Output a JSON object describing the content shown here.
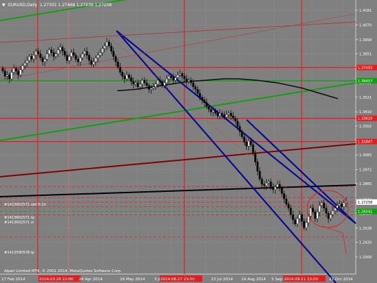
{
  "header": {
    "symbol": "EURUSD,Daily",
    "ohlc": "1.27331 1.27468 1.27239 1.27258"
  },
  "footer": {
    "copyright": "Alpari Limited MT4, © 2001-2014, MetaQuotes Software Corp."
  },
  "chart_data": {
    "type": "candlestick",
    "symbol": "EURUSD",
    "timeframe": "Daily",
    "ylim": [
      1.2309,
      1.4191
    ],
    "price_scale": [
      1.4181,
      1.407,
      1.3958,
      1.3851,
      1.3741,
      1.3633,
      1.3521,
      1.341,
      1.3302,
      1.3194,
      1.3083,
      1.2972,
      1.2865,
      1.2743,
      1.2639,
      1.2528,
      1.242,
      1.2309
    ],
    "price_tags": [
      {
        "value": "1.37463",
        "color": "#e02020"
      },
      {
        "value": "1.36457",
        "color": "#10a010"
      },
      {
        "value": "1.33610",
        "color": "#e02020"
      },
      {
        "value": "1.31847",
        "color": "#e02020"
      },
      {
        "value": "1.27258",
        "color": "#ffffff"
      },
      {
        "value": "1.26541",
        "color": "#10a010"
      }
    ],
    "time_scale": [
      "17 Feb 2014",
      "2014.03.20 22:00",
      "24 Apr 2014",
      "16 May 2014",
      "3 Jul 2014",
      "2014.06.27 23:00",
      "23 Jul 2014",
      "14 Aug 2014",
      "5 Sep 2014",
      "2014.09.21 23:00",
      "21 Oct 2014"
    ],
    "highlighted_dates": [
      "2014.03.20 22:00",
      "2014.06.27 23:00",
      "2014.09.21 23:00"
    ],
    "order_labels": [
      "#1413602571 sell 0.10",
      "#1413602571 tp",
      "#1413602571 sl",
      "#1413590578 tp"
    ],
    "closes": [
      1.372,
      1.368,
      1.369,
      1.366,
      1.371,
      1.374,
      1.372,
      1.369,
      1.373,
      1.376,
      1.378,
      1.38,
      1.383,
      1.381,
      1.384,
      1.387,
      1.385,
      1.382,
      1.379,
      1.381,
      1.385,
      1.388,
      1.386,
      1.383,
      1.385,
      1.388,
      1.39,
      1.387,
      1.384,
      1.38,
      1.383,
      1.386,
      1.384,
      1.381,
      1.379,
      1.382,
      1.385,
      1.387,
      1.384,
      1.38,
      1.377,
      1.379,
      1.382,
      1.384,
      1.386,
      1.389,
      1.391,
      1.394,
      1.391,
      1.387,
      1.383,
      1.379,
      1.375,
      1.371,
      1.368,
      1.366,
      1.369,
      1.367,
      1.364,
      1.362,
      1.363,
      1.36,
      1.362,
      1.365,
      1.363,
      1.361,
      1.358,
      1.359,
      1.36,
      1.362,
      1.365,
      1.364,
      1.361,
      1.363,
      1.366,
      1.368,
      1.367,
      1.365,
      1.367,
      1.369,
      1.37,
      1.368,
      1.366,
      1.364,
      1.365,
      1.363,
      1.36,
      1.358,
      1.355,
      1.352,
      1.35,
      1.348,
      1.345,
      1.343,
      1.341,
      1.342,
      1.34,
      1.338,
      1.34,
      1.339,
      1.337,
      1.339,
      1.34,
      1.338,
      1.336,
      1.334,
      1.33,
      1.326,
      1.322,
      1.318,
      1.315,
      1.319,
      1.316,
      1.31,
      1.303,
      1.296,
      1.29,
      1.286,
      1.285,
      1.287,
      1.288,
      1.284,
      1.282,
      1.284,
      1.286,
      1.283,
      1.279,
      1.275,
      1.271,
      1.268,
      1.263,
      1.259,
      1.256,
      1.26,
      1.263,
      1.258,
      1.253,
      1.257,
      1.262,
      1.268,
      1.265,
      1.26,
      1.265,
      1.27,
      1.272,
      1.268,
      1.264,
      1.26,
      1.263,
      1.266,
      1.268,
      1.27,
      1.271,
      1.269,
      1.272,
      1.273
    ],
    "moving_average": {
      "x": [
        0.33,
        0.38,
        0.43,
        0.48,
        0.53,
        0.58,
        0.63,
        0.67,
        0.72,
        0.78,
        0.85,
        0.9,
        0.95
      ],
      "y": [
        1.357,
        1.358,
        1.36,
        1.362,
        1.364,
        1.365,
        1.366,
        1.366,
        1.365,
        1.363,
        1.359,
        1.355,
        1.351
      ]
    }
  }
}
